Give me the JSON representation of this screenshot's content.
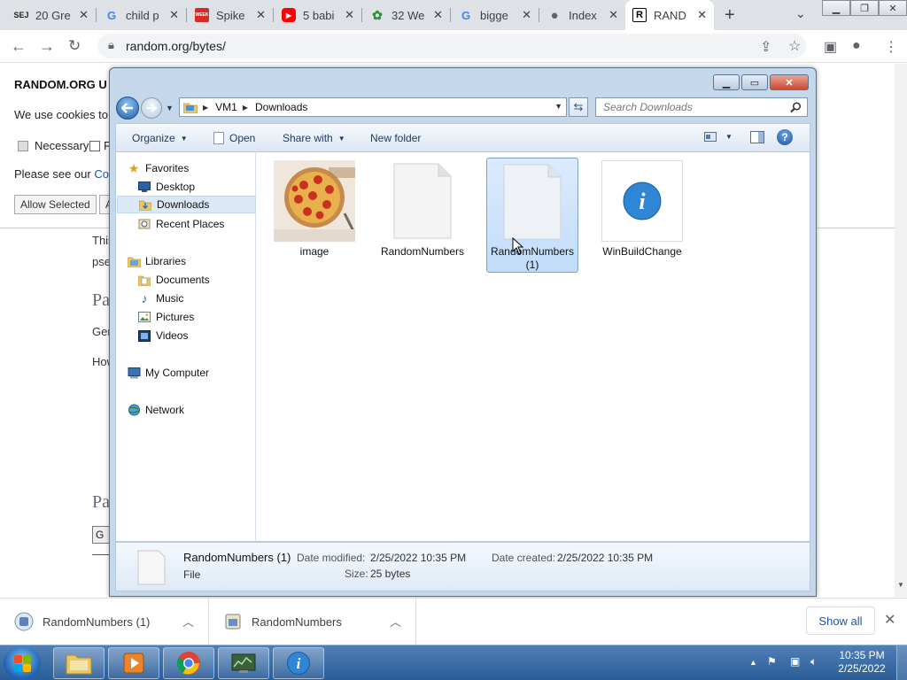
{
  "browser": {
    "tabs": [
      {
        "favicon_text": "SEJ",
        "favicon_color": "#222222",
        "title": "20 Gre"
      },
      {
        "favicon_text": "G",
        "favicon_color": "#4285f4",
        "title": "child p"
      },
      {
        "favicon_text": "WEEK",
        "favicon_color": "#d62b2b",
        "title": "Spike"
      },
      {
        "favicon_text": "▶",
        "favicon_color": "#ff0000",
        "title": "5 babi"
      },
      {
        "favicon_text": "✿",
        "favicon_color": "#2f8f3c",
        "title": "32 We"
      },
      {
        "favicon_text": "G",
        "favicon_color": "#4285f4",
        "title": "bigge"
      },
      {
        "favicon_text": "●",
        "favicon_color": "#5f6368",
        "title": "Index"
      },
      {
        "favicon_text": "R",
        "favicon_color": "#000000",
        "title": "RAND"
      }
    ],
    "url": "random.org/bytes/"
  },
  "page": {
    "cookie_heading": "RANDOM.ORG U",
    "cookie_text": "We use cookies to",
    "necessary_label": "Necessary",
    "second_label": "F",
    "see_our": "Please see our",
    "see_our_link": "Coo",
    "allow_selected": "Allow Selected",
    "allow_other": "A",
    "body_lines": [
      "This",
      "pse",
      "Gen",
      "How"
    ],
    "heading_1": "Pa",
    "heading_2": "Pa",
    "gen_button": "G"
  },
  "explorer": {
    "breadcrumb": [
      "VM1",
      "Downloads"
    ],
    "search_placeholder": "Search Downloads",
    "commands": {
      "organize": "Organize",
      "open": "Open",
      "share_with": "Share with",
      "new_folder": "New folder"
    },
    "nav": {
      "favorites": "Favorites",
      "desktop": "Desktop",
      "downloads": "Downloads",
      "recent_places": "Recent Places",
      "libraries": "Libraries",
      "documents": "Documents",
      "music": "Music",
      "pictures": "Pictures",
      "videos": "Videos",
      "my_computer": "My Computer",
      "network": "Network"
    },
    "files": [
      {
        "name": "image",
        "kind": "image"
      },
      {
        "name": "RandomNumbers",
        "kind": "file"
      },
      {
        "name": "RandomNumbers (1)",
        "kind": "file",
        "selected": true
      },
      {
        "name": "WinBuildChange",
        "kind": "info"
      }
    ],
    "details": {
      "name": "RandomNumbers (1)",
      "type": "File",
      "date_modified_label": "Date modified:",
      "date_modified": "2/25/2022 10:35 PM",
      "date_created_label": "Date created:",
      "date_created": "2/25/2022 10:35 PM",
      "size_label": "Size:",
      "size": "25 bytes"
    }
  },
  "downloads_shelf": {
    "items": [
      "RandomNumbers (1)",
      "RandomNumbers"
    ],
    "show_all": "Show all"
  },
  "taskbar": {
    "time": "10:35 PM",
    "date": "2/25/2022"
  }
}
